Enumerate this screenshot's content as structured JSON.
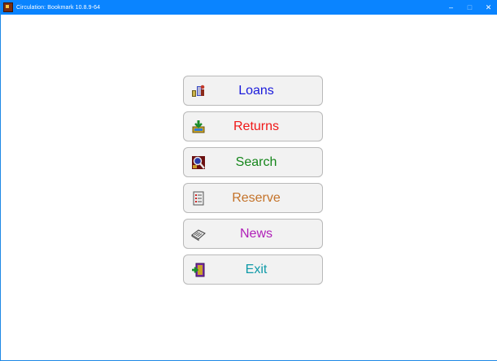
{
  "window": {
    "title": "Circulation: Bookmark 10.8.9-64",
    "controls": {
      "minimize": "–",
      "maximize": "□",
      "close": "✕"
    }
  },
  "menu": {
    "items": [
      {
        "label": "Loans",
        "color": "#1a1adb",
        "icon": "loans-icon"
      },
      {
        "label": "Returns",
        "color": "#f01818",
        "icon": "returns-icon"
      },
      {
        "label": "Search",
        "color": "#16861c",
        "icon": "search-icon"
      },
      {
        "label": "Reserve",
        "color": "#c4732a",
        "icon": "reserve-icon"
      },
      {
        "label": "News",
        "color": "#b020b8",
        "icon": "news-icon"
      },
      {
        "label": "Exit",
        "color": "#0f9aa8",
        "icon": "exit-icon"
      }
    ]
  },
  "colors": {
    "titlebar": "#0a84ff",
    "button_bg": "#f2f2f2",
    "button_border": "#b9b9b9"
  }
}
